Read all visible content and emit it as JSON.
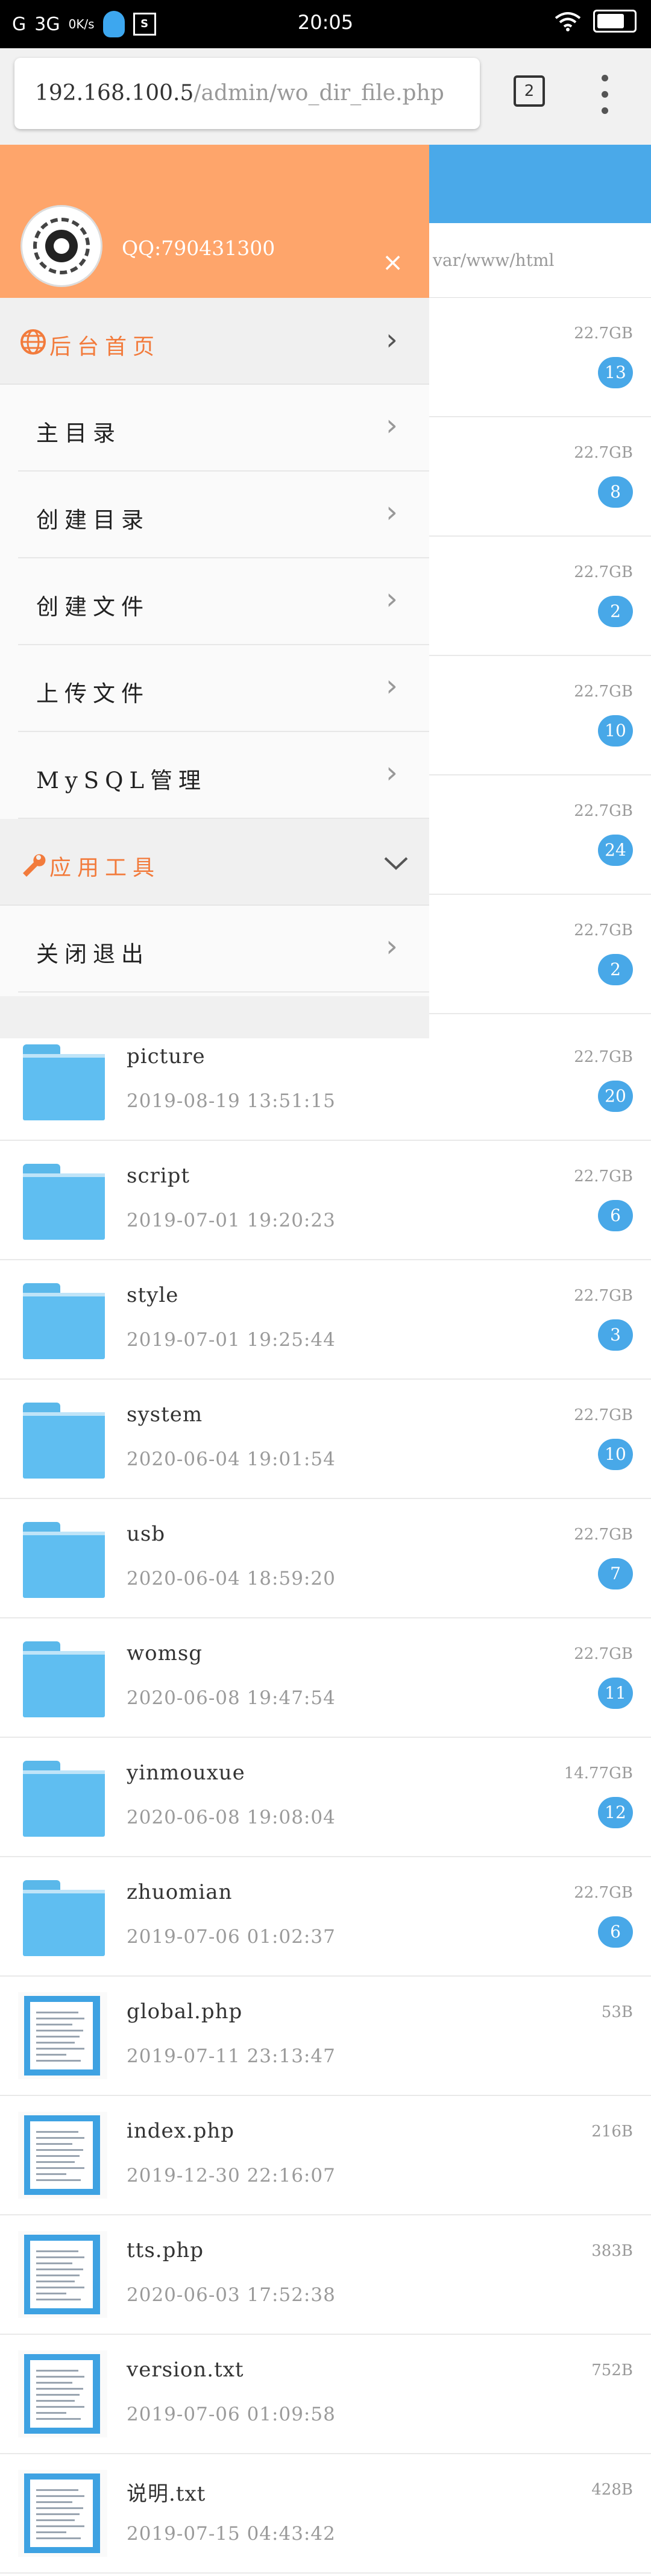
{
  "status_bar": {
    "signal1": "G",
    "network": "3G",
    "speed": "0K/s",
    "s_icon_text": "S",
    "time": "20:05"
  },
  "browser": {
    "url_host": "192.168.100.5",
    "url_path": "/admin/wo_dir_file.php",
    "tab_count": "2"
  },
  "path_text": "var/www/html",
  "drawer": {
    "qq": "QQ:790431300",
    "close_symbol": "×",
    "section_home": "后台首页",
    "items": [
      {
        "label": "主目录"
      },
      {
        "label": "创建目录"
      },
      {
        "label": "创建文件"
      },
      {
        "label": "上传文件"
      },
      {
        "label": "MySQL管理"
      }
    ],
    "section_tools": "应用工具",
    "logout": "关闭退出"
  },
  "hidden_rows": [
    {
      "size": "22.7GB",
      "count": "13"
    },
    {
      "size": "22.7GB",
      "count": "8"
    },
    {
      "size": "22.7GB",
      "count": "2"
    },
    {
      "size": "22.7GB",
      "count": "10"
    },
    {
      "size": "22.7GB",
      "count": "24"
    },
    {
      "size": "22.7GB",
      "count": "2"
    }
  ],
  "entries": [
    {
      "type": "folder",
      "name": "picture",
      "date": "2019-08-19 13:51:15",
      "size": "22.7GB",
      "count": "20"
    },
    {
      "type": "folder",
      "name": "script",
      "date": "2019-07-01 19:20:23",
      "size": "22.7GB",
      "count": "6"
    },
    {
      "type": "folder",
      "name": "style",
      "date": "2019-07-01 19:25:44",
      "size": "22.7GB",
      "count": "3"
    },
    {
      "type": "folder",
      "name": "system",
      "date": "2020-06-04 19:01:54",
      "size": "22.7GB",
      "count": "10"
    },
    {
      "type": "folder",
      "name": "usb",
      "date": "2020-06-04 18:59:20",
      "size": "22.7GB",
      "count": "7"
    },
    {
      "type": "folder",
      "name": "womsg",
      "date": "2020-06-08 19:47:54",
      "size": "22.7GB",
      "count": "11"
    },
    {
      "type": "folder",
      "name": "yinmouxue",
      "date": "2020-06-08 19:08:04",
      "size": "14.77GB",
      "count": "12"
    },
    {
      "type": "folder",
      "name": "zhuomian",
      "date": "2019-07-06 01:02:37",
      "size": "22.7GB",
      "count": "6"
    },
    {
      "type": "file",
      "name": "global.php",
      "date": "2019-07-11 23:13:47",
      "size": "53B"
    },
    {
      "type": "file",
      "name": "index.php",
      "date": "2019-12-30 22:16:07",
      "size": "216B"
    },
    {
      "type": "file",
      "name": "tts.php",
      "date": "2020-06-03 17:52:38",
      "size": "383B"
    },
    {
      "type": "file",
      "name": "version.txt",
      "date": "2019-07-06 01:09:58",
      "size": "752B"
    },
    {
      "type": "file",
      "name": "说明.txt",
      "date": "2019-07-15 04:43:42",
      "size": "428B"
    }
  ]
}
